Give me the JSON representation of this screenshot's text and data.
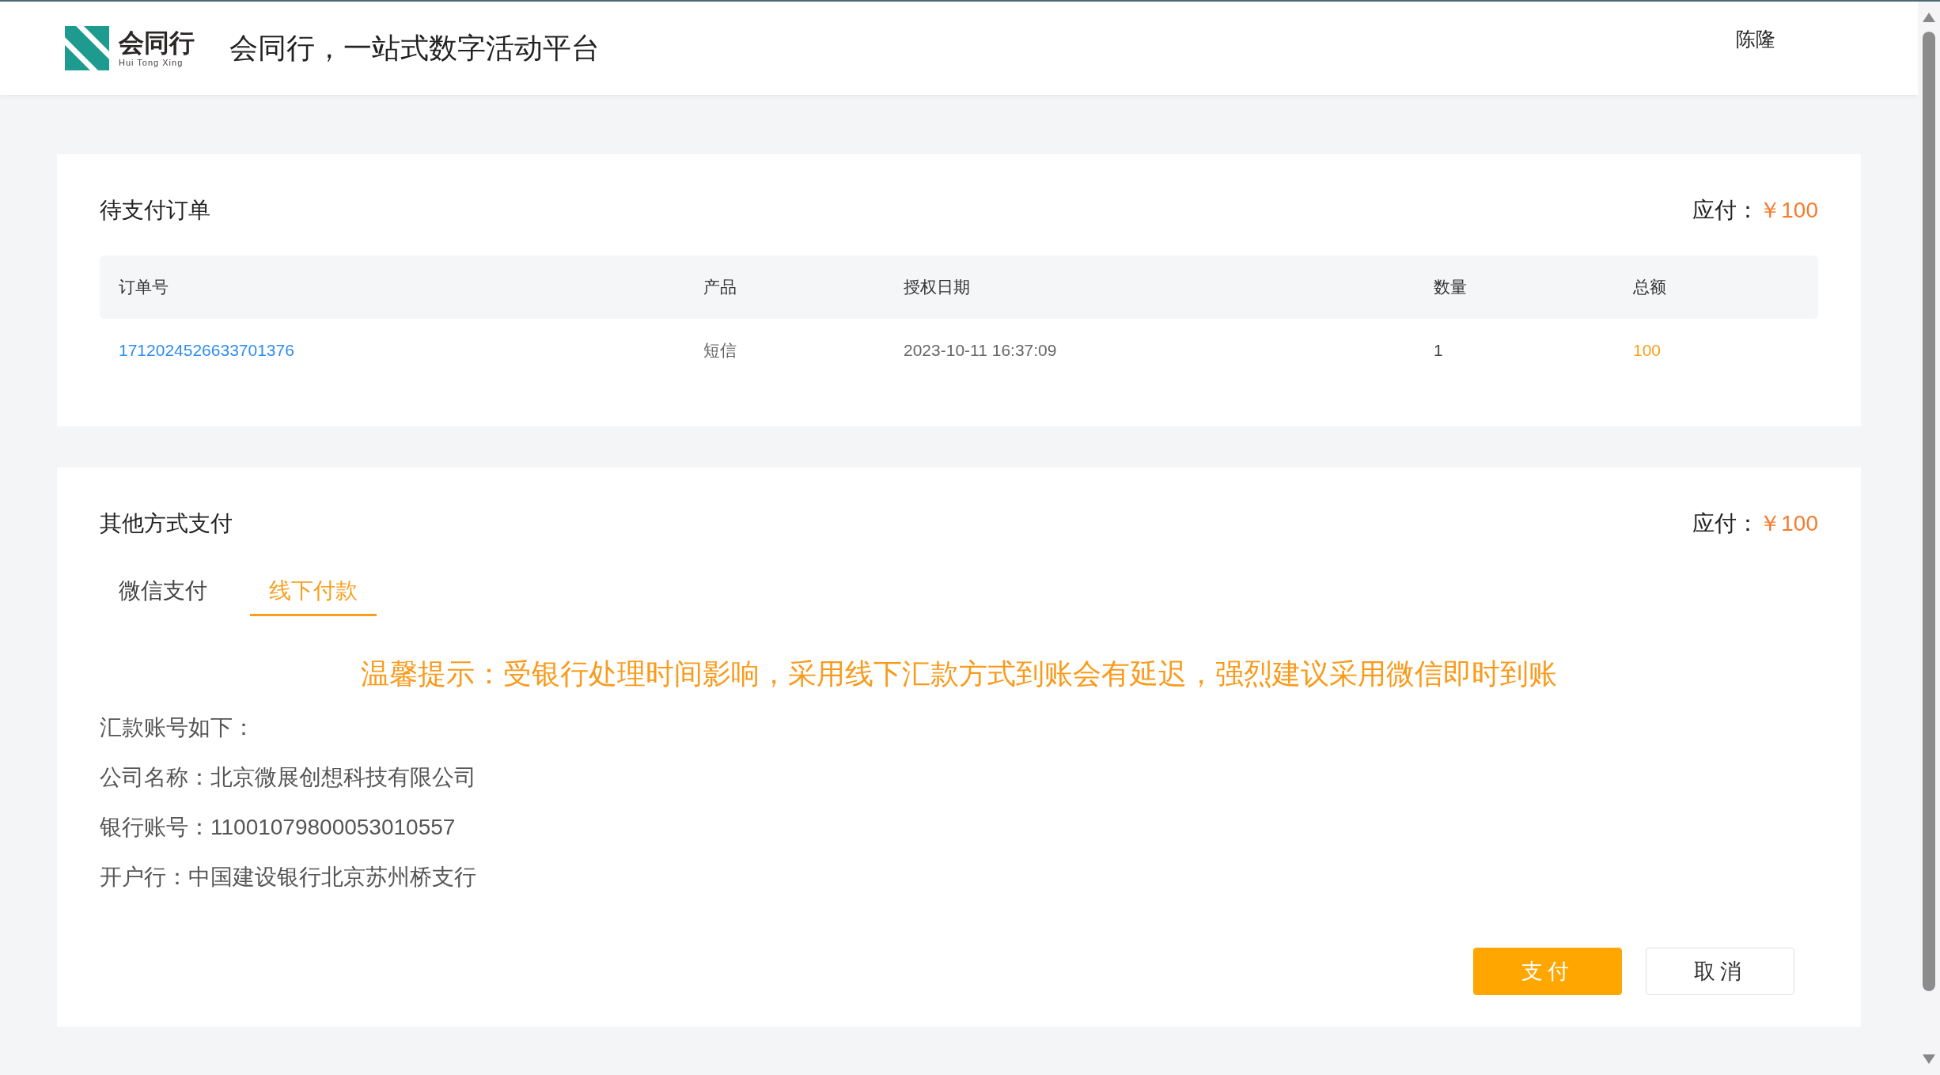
{
  "header": {
    "logo_text": "会同行",
    "logo_subtext": "Hui Tong Xing",
    "title": "会同行，一站式数字活动平台",
    "user": "陈隆"
  },
  "order": {
    "title": "待支付订单",
    "due_label": "应付：",
    "due_amount": "￥100",
    "columns": [
      "订单号",
      "产品",
      "授权日期",
      "数量",
      "总额"
    ],
    "rows": [
      {
        "order_no": "1712024526633701376",
        "product": "短信",
        "date": "2023-10-11 16:37:09",
        "quantity": "1",
        "total": "100"
      }
    ]
  },
  "payment": {
    "title": "其他方式支付",
    "due_label": "应付：",
    "due_amount": "￥100",
    "tabs": [
      {
        "label": "微信支付",
        "selected": false
      },
      {
        "label": "线下付款",
        "selected": true
      }
    ],
    "notice": "温馨提示：受银行处理时间影响，采用线下汇款方式到账会有延迟，强烈建议采用微信即时到账",
    "details": [
      "汇款账号如下：",
      "公司名称：北京微展创想科技有限公司",
      "银行账号：11001079800053010557",
      "开户行：中国建设银行北京苏州桥支行"
    ],
    "buttons": [
      {
        "label": "支付",
        "kind": "primary"
      },
      {
        "label": "取消",
        "kind": "secondary"
      }
    ]
  }
}
